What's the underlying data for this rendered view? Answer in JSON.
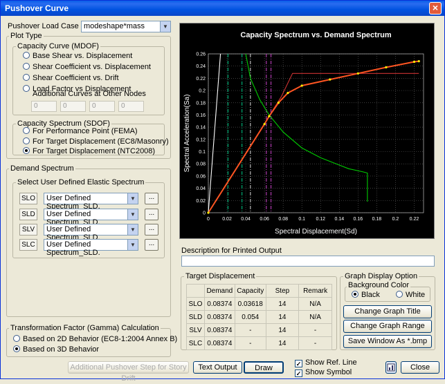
{
  "window": {
    "title": "Pushover Curve"
  },
  "load_case": {
    "label": "Pushover Load Case",
    "value": "modeshape*mass"
  },
  "plot_type": {
    "label": "Plot Type",
    "capacity_curve": {
      "label": "Capacity Curve (MDOF)",
      "options": [
        "Base Shear vs. Displacement",
        "Shear Coefficient vs. Displacement",
        "Shear Coefficient vs. Drift",
        "Load Factor vs Displacement"
      ],
      "additional_label": "Additional Curves at Other Nodes",
      "nodes": [
        "0",
        "0",
        "0",
        "0"
      ]
    },
    "capacity_spectrum": {
      "label": "Capacity Spectrum (SDOF)",
      "options": [
        "For Performance Point (FEMA)",
        "For Target Displacement (EC8/Masonry)",
        "For Target Displacement (NTC2008)"
      ],
      "selected": 2
    }
  },
  "demand_spectrum": {
    "label": "Demand Spectrum",
    "sub_label": "Select User Defined Elastic Spectrum",
    "rows": [
      {
        "tag": "SLO",
        "value": "User Defined Spectrum_SLD."
      },
      {
        "tag": "SLD",
        "value": "User Defined Spectrum_SLD."
      },
      {
        "tag": "SLV",
        "value": "User Defined Spectrum_SLD."
      },
      {
        "tag": "SLC",
        "value": "User Defined Spectrum_SLD."
      }
    ],
    "ellipsis": "..."
  },
  "gamma": {
    "label": "Transformation Factor (Gamma) Calculation",
    "options": [
      "Based on 2D Behavior (EC8-1:2004  Annex B)",
      "Based on 3D Behavior"
    ],
    "selected": 1
  },
  "chart_data": {
    "type": "line",
    "title": "Capacity Spectrum vs. Demand Spectrum",
    "xlabel": "Spectral Displacement(Sd)",
    "ylabel": "Spectral Acceleration(Sa)",
    "xlim": [
      0,
      0.23
    ],
    "ylim": [
      0,
      0.26
    ],
    "x_ticks": [
      "0",
      "0.02",
      "0.04",
      "0.06",
      "0.08",
      "0.1",
      "0.12",
      "0.14",
      "0.16",
      "0.18",
      "0.2",
      "0.22"
    ],
    "y_ticks": [
      "0",
      "0.02",
      "0.04",
      "0.06",
      "0.08",
      "0.1",
      "0.12",
      "0.14",
      "0.16",
      "0.18",
      "0.2",
      "0.22",
      "0.24",
      "0.26"
    ],
    "background": "#000000",
    "series": [
      {
        "color": "#ffffff",
        "points": [
          [
            0,
            0
          ],
          [
            0.013,
            0.26
          ]
        ]
      },
      {
        "color": "#00cc00",
        "points": [
          [
            0.04,
            0.26
          ],
          [
            0.045,
            0.22
          ],
          [
            0.055,
            0.185
          ],
          [
            0.065,
            0.16
          ],
          [
            0.08,
            0.132
          ],
          [
            0.1,
            0.106
          ],
          [
            0.12,
            0.09
          ],
          [
            0.14,
            0.078
          ],
          [
            0.15,
            0.072
          ],
          [
            0.165,
            0.067
          ],
          [
            0.17,
            0.065
          ],
          [
            0.17,
            0.018
          ]
        ]
      },
      {
        "color": "#cc3333",
        "points": [
          [
            0,
            0
          ],
          [
            0.078,
            0.19
          ],
          [
            0.09,
            0.228
          ],
          [
            0.225,
            0.228
          ]
        ]
      },
      {
        "color": "#ff5522",
        "points": [
          [
            0,
            0
          ],
          [
            0.06,
            0.145
          ],
          [
            0.065,
            0.158
          ],
          [
            0.075,
            0.18
          ],
          [
            0.085,
            0.196
          ],
          [
            0.1,
            0.208
          ],
          [
            0.13,
            0.218
          ],
          [
            0.16,
            0.228
          ],
          [
            0.19,
            0.238
          ],
          [
            0.22,
            0.247
          ],
          [
            0.225,
            0.248
          ]
        ]
      }
    ],
    "ref_lines": [
      {
        "x": 0.021,
        "color": "#00cc88"
      },
      {
        "x": 0.036,
        "color": "#00cc88"
      },
      {
        "x": 0.045,
        "color": "#dddddd"
      },
      {
        "x": 0.062,
        "color": "#cc44cc"
      },
      {
        "x": 0.067,
        "color": "#cc44cc"
      }
    ]
  },
  "description": {
    "label": "Description for Printed Output",
    "value": ""
  },
  "target_displacement": {
    "label": "Target Displacement",
    "headers": [
      "",
      "Demand",
      "Capacity",
      "Step",
      "Remark"
    ],
    "rows": [
      [
        "SLO",
        "0.08374",
        "0.03618",
        "14",
        "N/A"
      ],
      [
        "SLD",
        "0.08374",
        "0.054",
        "14",
        "N/A"
      ],
      [
        "SLV",
        "0.08374",
        "-",
        "14",
        "-"
      ],
      [
        "SLC",
        "0.08374",
        "-",
        "14",
        "-"
      ]
    ]
  },
  "graph_option": {
    "label": "Graph Display Option",
    "bg_label": "Background Color",
    "bg_options": [
      "Black",
      "White"
    ],
    "bg_selected": 0,
    "buttons": [
      "Change Graph Title",
      "Change Graph Range",
      "Save Window As *.bmp"
    ]
  },
  "bottom": {
    "additional_btn": "Additional Pushover Step for Story Drift",
    "text_output_btn": "Text Output",
    "draw_btn": "Draw",
    "show_ref_line": "Show Ref. Line",
    "show_symbol": "Show Symbol",
    "close_btn": "Close"
  }
}
